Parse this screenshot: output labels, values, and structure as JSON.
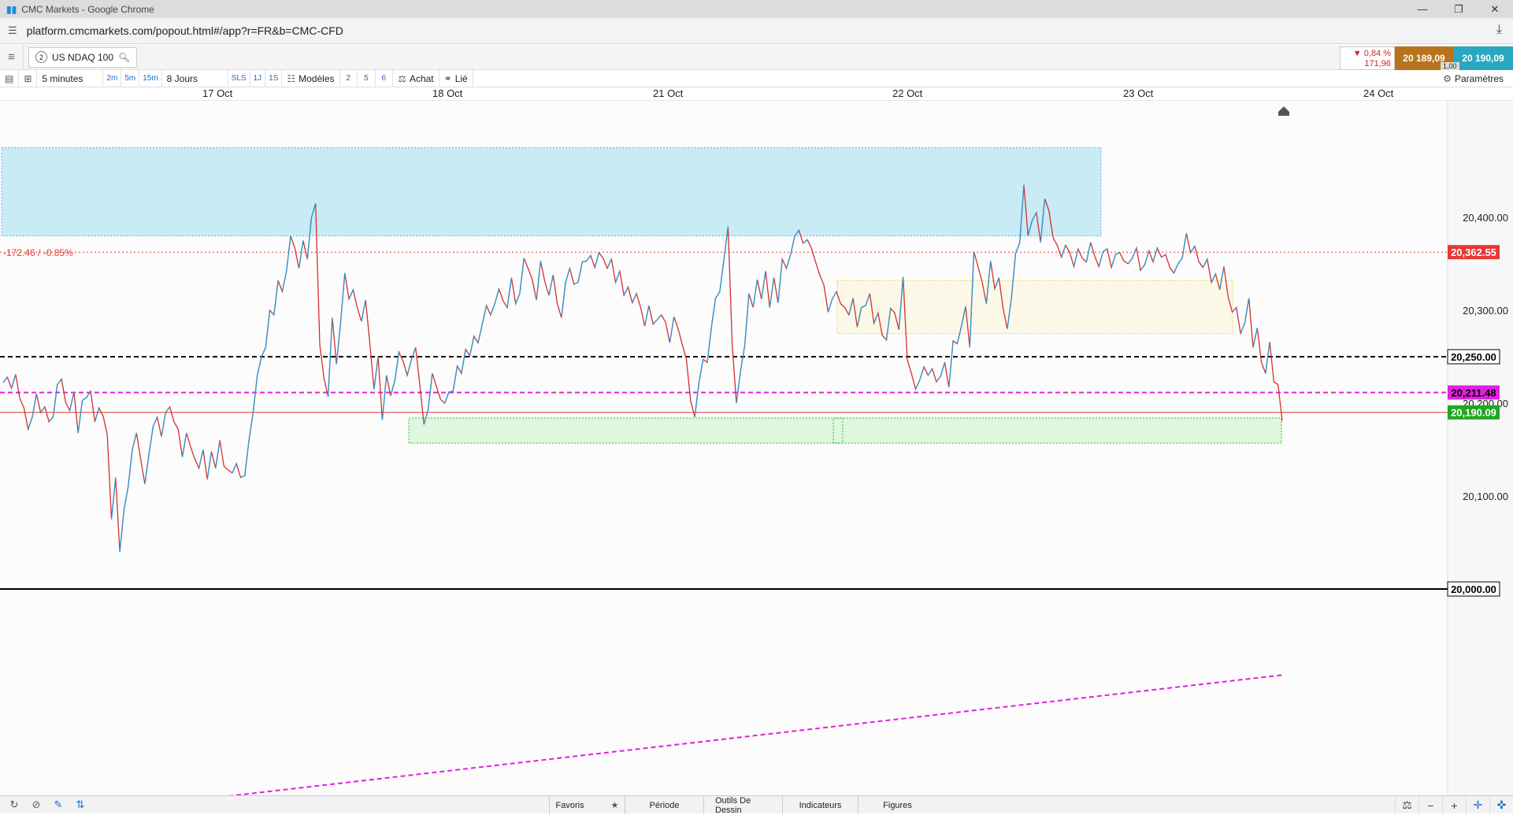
{
  "browser": {
    "window_title": "CMC Markets - Google Chrome",
    "url": "platform.cmcmarkets.com/popout.html#/app?r=FR&b=CMC-CFD"
  },
  "instrument": {
    "tab_number": "2",
    "name": "US NDAQ 100"
  },
  "quote": {
    "change_pct": "▼ 0,84 %",
    "change_pts": "171,96",
    "sell": "20 189,09",
    "buy": "20 190,09",
    "spread": "1,00",
    "colors": {
      "sell": "#b9731d",
      "buy": "#2aa7c0",
      "down": "#c62828"
    }
  },
  "toolbar": {
    "timeframe": "5 minutes",
    "tf_buttons": [
      "2m",
      "5m",
      "15m"
    ],
    "range": "8 Jours",
    "sls": "SLS",
    "j1": "1J",
    "s1": "1S",
    "models": "Modèles",
    "n2": "2",
    "n5": "5",
    "n6": "6",
    "buy_label": "Achat",
    "linked": "Lié",
    "settings": "Paramètres"
  },
  "dates": [
    "17 Oct",
    "18 Oct",
    "21 Oct",
    "22 Oct",
    "23 Oct",
    "24 Oct"
  ],
  "chart_data": {
    "type": "line",
    "timeframe": "5 minutes",
    "x": [
      "17 Oct",
      "18 Oct",
      "21 Oct",
      "22 Oct",
      "23 Oct",
      "24 Oct"
    ],
    "y_ticks": [
      "20,400.00",
      "20,300.00",
      "20,200.00",
      "20,100.00",
      "20,000.00"
    ],
    "ylim": [
      19940,
      20480
    ],
    "annotation": "-172.46 / -0.85%",
    "levels": [
      {
        "label": "20,362.55",
        "value": 20362.55,
        "color": "#e53935",
        "style": "dotted"
      },
      {
        "label": "20,250.00",
        "value": 20250,
        "color": "#000000",
        "style": "dashed"
      },
      {
        "label": "20,211.48",
        "value": 20211.48,
        "color": "#e020e0",
        "style": "dashed"
      },
      {
        "label": "20,190.09",
        "value": 20190.09,
        "color": "#1fa81f",
        "style": "solid-red"
      },
      {
        "label": "20,000.00",
        "value": 20000,
        "color": "#000000",
        "style": "solid"
      }
    ],
    "series": [
      {
        "values": [
          20222,
          20228,
          20216,
          20231,
          20205,
          20195,
          20172,
          20185,
          20210,
          20190,
          20196,
          20180,
          20185,
          20220,
          20226,
          20201,
          20192,
          20212,
          20168,
          20203,
          20206,
          20213,
          20180,
          20195,
          20186,
          20166,
          20075,
          20120,
          20040,
          20085,
          20110,
          20150,
          20168,
          20140,
          20113,
          20145,
          20175,
          20185,
          20164,
          20190,
          20196,
          20180,
          20172,
          20142,
          20168,
          20153,
          20140,
          20130,
          20150,
          20118,
          20148,
          20130,
          20160,
          20132,
          20128,
          20125,
          20135,
          20120,
          20122,
          20160,
          20190,
          20230,
          20250,
          20260,
          20300,
          20295,
          20332,
          20320,
          20342,
          20380,
          20367,
          20345,
          20375,
          20355,
          20400,
          20415,
          20263,
          20227,
          20207,
          20292,
          20242,
          20287,
          20340,
          20312,
          20322,
          20303,
          20288,
          20311,
          20265,
          20215,
          20250,
          20182,
          20230,
          20208,
          20224,
          20255,
          20245,
          20230,
          20247,
          20260,
          20220,
          20177,
          20193,
          20232,
          20218,
          20204,
          20200,
          20212,
          20213,
          20240,
          20232,
          20258,
          20251,
          20272,
          20265,
          20285,
          20305,
          20295,
          20307,
          20323,
          20310,
          20303,
          20335,
          20307,
          20318,
          20356,
          20345,
          20333,
          20311,
          20353,
          20331,
          20316,
          20338,
          20307,
          20292,
          20330,
          20345,
          20328,
          20330,
          20352,
          20353,
          20359,
          20346,
          20362,
          20356,
          20345,
          20355,
          20330,
          20342,
          20316,
          20325,
          20308,
          20318,
          20303,
          20283,
          20305,
          20285,
          20290,
          20295,
          20287,
          20265,
          20293,
          20280,
          20263,
          20247,
          20203,
          20185,
          20222,
          20247,
          20244,
          20282,
          20313,
          20320,
          20355,
          20390,
          20262,
          20200,
          20235,
          20262,
          20318,
          20303,
          20333,
          20312,
          20342,
          20303,
          20335,
          20308,
          20355,
          20345,
          20360,
          20380,
          20386,
          20372,
          20376,
          20367,
          20352,
          20338,
          20327,
          20298,
          20312,
          20320,
          20307,
          20303,
          20295,
          20313,
          20282,
          20303,
          20305,
          20318,
          20286,
          20297,
          20273,
          20268,
          20302,
          20297,
          20279,
          20336,
          20247,
          20232,
          20215,
          20225,
          20239,
          20230,
          20237,
          20223,
          20229,
          20244,
          20217,
          20267,
          20264,
          20283,
          20304,
          20260,
          20363,
          20347,
          20330,
          20307,
          20353,
          20323,
          20335,
          20302,
          20280,
          20313,
          20361,
          20373,
          20435,
          20380,
          20397,
          20405,
          20373,
          20420,
          20407,
          20378,
          20370,
          20357,
          20370,
          20362,
          20347,
          20366,
          20356,
          20352,
          20373,
          20358,
          20347,
          20363,
          20366,
          20346,
          20360,
          20362,
          20353,
          20350,
          20356,
          20367,
          20343,
          20349,
          20364,
          20352,
          20367,
          20357,
          20360,
          20346,
          20340,
          20350,
          20356,
          20383,
          20362,
          20369,
          20352,
          20346,
          20355,
          20330,
          20339,
          20322,
          20347,
          20315,
          20298,
          20303,
          20275,
          20286,
          20313,
          20260,
          20281,
          20244,
          20232,
          20266,
          20223,
          20220,
          20181
        ]
      }
    ],
    "zones": [
      {
        "name": "resistance-zone",
        "from": 20380,
        "to": 20475,
        "color": "#bfe8f5"
      },
      {
        "name": "range-zone",
        "from": 20275,
        "to": 20332,
        "color": "#fbf7e4"
      },
      {
        "name": "support-zone",
        "from": 20157,
        "to": 20184,
        "color": "#d8f6d8"
      }
    ]
  },
  "bottombar": {
    "tabs": [
      "Favoris",
      "Période",
      "Outils De Dessin",
      "Indicateurs",
      "Figures"
    ]
  }
}
